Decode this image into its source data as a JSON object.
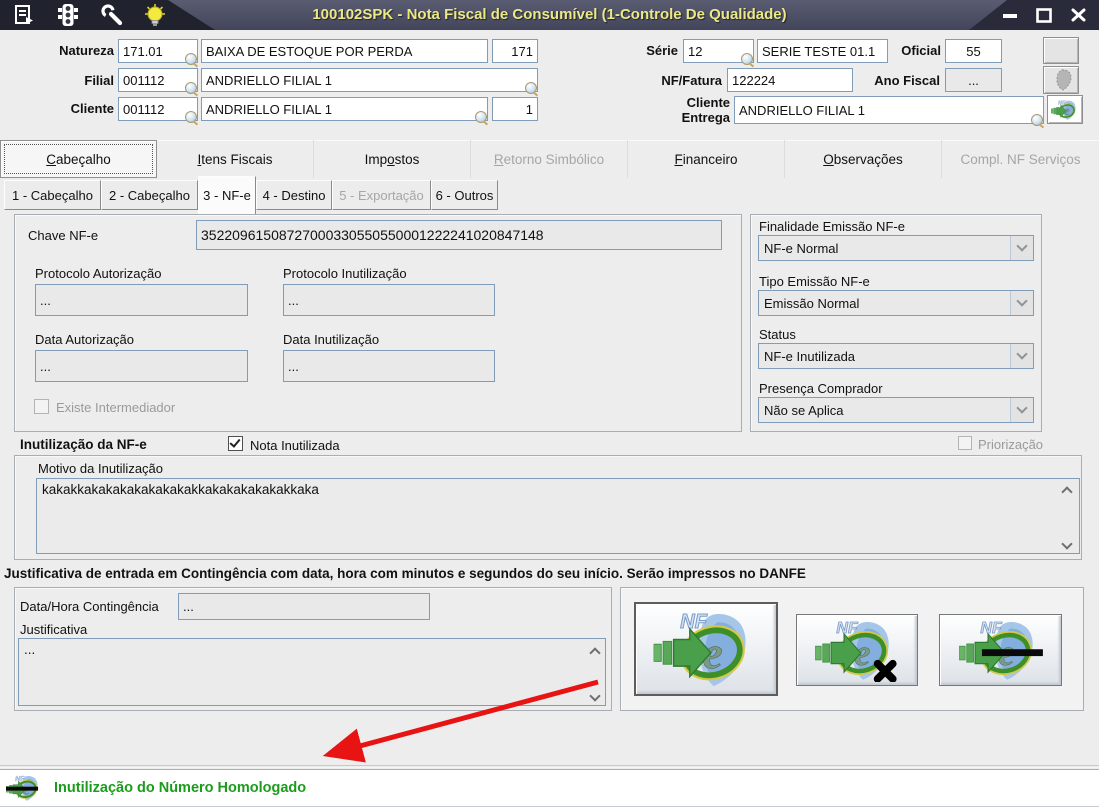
{
  "titlebar": {
    "title": "100102SPK - Nota Fiscal de Consumível (1-Controle De Qualidade)"
  },
  "icons": {
    "titlebar": [
      "form-icon",
      "traffic-light-icon",
      "wrench-icon",
      "bulb-icon"
    ],
    "window_controls": [
      "minimize",
      "maximize",
      "close"
    ],
    "lookup": "magnifier-icon",
    "combo_arrow": "chevron-down-icon",
    "scrollbar": [
      "chevron-up-icon",
      "chevron-down-icon"
    ],
    "nfe_logo": {
      "nf_text": "NF",
      "e_text": "e"
    },
    "action_buttons": [
      "nfe-logo-icon",
      "nfe-logo-x-icon",
      "nfe-logo-strike-icon"
    ],
    "statusbar": "nfe-logo-strike-icon"
  },
  "header": {
    "natureza": {
      "label": "Natureza",
      "code": "171.01",
      "desc": "BAIXA DE ESTOQUE POR PERDA",
      "num": "171"
    },
    "filial": {
      "label": "Filial",
      "code": "001112",
      "desc": "ANDRIELLO FILIAL 1"
    },
    "cliente": {
      "label": "Cliente",
      "code": "001112",
      "desc": "ANDRIELLO FILIAL 1",
      "loja": "1"
    },
    "serie": {
      "label": "Série",
      "code": "12",
      "desc": "SERIE TESTE 01.1"
    },
    "oficial": {
      "label": "Oficial",
      "value": "55"
    },
    "nf_fatura": {
      "label": "NF/Fatura",
      "value": "122224"
    },
    "ano_fiscal": {
      "label": "Ano Fiscal",
      "value": "..."
    },
    "cliente_entrega": {
      "label_line1": "Cliente",
      "label_line2": "Entrega",
      "value": "ANDRIELLO FILIAL 1"
    }
  },
  "main_tabs": [
    {
      "label": "Cabeçalho",
      "state": "active"
    },
    {
      "label": "Itens Fiscais",
      "state": "normal"
    },
    {
      "label": "Impostos",
      "state": "normal"
    },
    {
      "label": "Retorno Simbólico",
      "state": "disabled"
    },
    {
      "label": "Financeiro",
      "state": "normal"
    },
    {
      "label": "Observações",
      "state": "normal"
    },
    {
      "label": "Compl. NF Serviços",
      "state": "disabled"
    }
  ],
  "sub_tabs": [
    {
      "label": "1 - Cabeçalho",
      "state": "normal"
    },
    {
      "label": "2 - Cabeçalho",
      "state": "normal"
    },
    {
      "label": "3 - NF-e",
      "state": "active"
    },
    {
      "label": "4 - Destino",
      "state": "normal"
    },
    {
      "label": "5 - Exportação",
      "state": "disabled"
    },
    {
      "label": "6 - Outros",
      "state": "normal"
    }
  ],
  "nfe": {
    "chave": {
      "label": "Chave NF-e",
      "value": "35220961508727000330550550001222241020847148"
    },
    "protocolo_autorizacao": {
      "label": "Protocolo Autorização",
      "value": "..."
    },
    "protocolo_inutilizacao": {
      "label": "Protocolo Inutilização",
      "value": "..."
    },
    "data_autorizacao": {
      "label": "Data Autorização",
      "value": "..."
    },
    "data_inutilizacao": {
      "label": "Data Inutilização",
      "value": "..."
    },
    "existe_intermediador": {
      "label": "Existe Intermediador",
      "checked": false
    }
  },
  "emissao": {
    "finalidade": {
      "label": "Finalidade Emissão NF-e",
      "value": "NF-e Normal"
    },
    "tipo": {
      "label": "Tipo Emissão NF-e",
      "value": "Emissão Normal"
    },
    "status": {
      "label": "Status",
      "value": "NF-e Inutilizada"
    },
    "presenca": {
      "label": "Presença Comprador",
      "value": "Não se Aplica"
    }
  },
  "inutilizacao": {
    "title": "Inutilização da NF-e",
    "nota_inutilizada": {
      "label": "Nota Inutilizada",
      "checked": true
    },
    "priorizacao": {
      "label": "Priorização",
      "checked": false
    },
    "motivo": {
      "label": "Motivo da Inutilização",
      "value": "kakakkakakakakakakakakkakakakakakakkaka"
    }
  },
  "contingencia": {
    "heading": "Justificativa de entrada em Contingência com data, hora com minutos e segundos do seu início. Serão impressos no DANFE",
    "data_hora": {
      "label": "Data/Hora Contingência",
      "value": "..."
    },
    "justificativa": {
      "label": "Justificativa",
      "value": "..."
    }
  },
  "statusbar": {
    "message": "Inutilização do Número Homologado"
  },
  "colors": {
    "titlebar_bg": "#4a4c62",
    "title_text": "#ebe986",
    "input_border": "#7f9db9",
    "status_green": "#1c9c1c",
    "arrow_red": "#e81313",
    "disabled_text": "#9a9a9a"
  }
}
